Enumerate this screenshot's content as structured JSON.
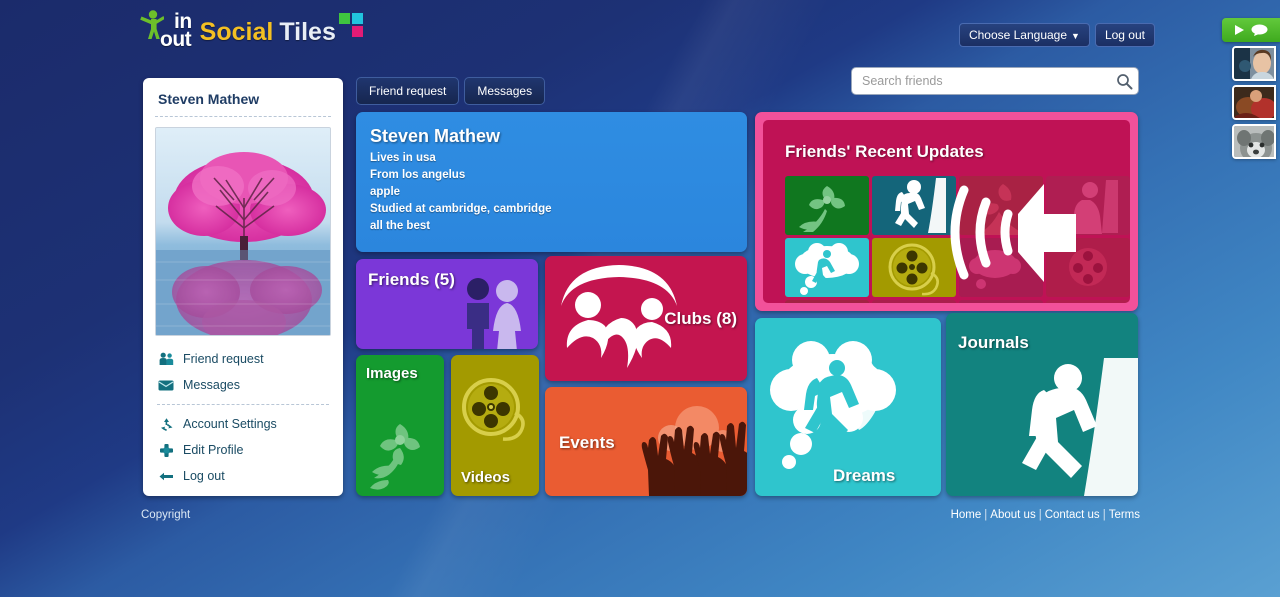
{
  "brand": {
    "in": "in",
    "out": "out",
    "social": "Social",
    "tiles": "Tiles"
  },
  "header": {
    "language_button": "Choose Language",
    "language_caret": "▼",
    "logout_button": "Log out"
  },
  "tabs": [
    {
      "label": "Friend request"
    },
    {
      "label": "Messages"
    }
  ],
  "search": {
    "placeholder": "Search friends",
    "value": ""
  },
  "sidebar": {
    "user_name": "Steven Mathew",
    "items": [
      {
        "label": "Friend request",
        "icon": "friends-icon"
      },
      {
        "label": "Messages",
        "icon": "envelope-icon"
      },
      {
        "label": "Account Settings",
        "icon": "settings-icon"
      },
      {
        "label": "Edit Profile",
        "icon": "edit-profile-icon"
      },
      {
        "label": "Log out",
        "icon": "logout-arrow-icon"
      }
    ]
  },
  "profile": {
    "name": "Steven Mathew",
    "lives_in": "Lives in usa",
    "from": "From los angelus",
    "work": "apple",
    "studied": "Studied at cambridge, cambridge",
    "bio": "all the best"
  },
  "tiles": {
    "friends": {
      "label": "Friends (5)",
      "color": "#7b37d8"
    },
    "images": {
      "label": "Images",
      "color": "#149b2f"
    },
    "videos": {
      "label": "Videos",
      "color": "#a39a00"
    },
    "clubs": {
      "label": "Clubs (8)",
      "color": "#c4154f"
    },
    "events": {
      "label": "Events",
      "color": "#ea5c32"
    },
    "dreams": {
      "label": "Dreams",
      "color": "#2fc5cd"
    },
    "journals": {
      "label": "Journals",
      "color": "#12837f"
    }
  },
  "updates": {
    "title": "Friends' Recent Updates",
    "frame_color": "#f2519a",
    "panel_color": "#bf1255"
  },
  "footer": {
    "copyright": "Copyright",
    "links": [
      {
        "label": "Home"
      },
      {
        "label": "About us"
      },
      {
        "label": "Contact us"
      },
      {
        "label": "Terms"
      }
    ],
    "separator": "|"
  },
  "chat": {
    "bar_color": "#4fba2b",
    "avatar_count": 3
  }
}
